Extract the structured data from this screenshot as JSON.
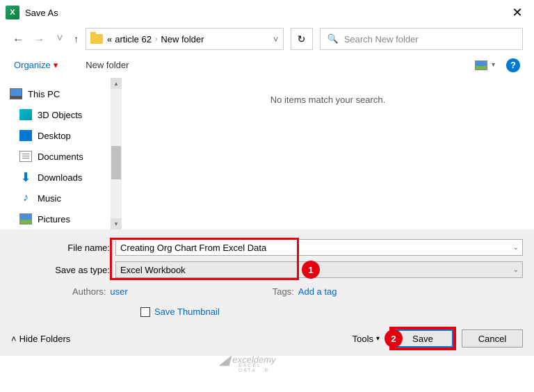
{
  "title": "Save As",
  "breadcrumb": {
    "prefix": "«",
    "p1": "article 62",
    "p2": "New folder"
  },
  "search": {
    "placeholder": "Search New folder"
  },
  "cmdbar": {
    "organize": "Organize",
    "newfolder": "New folder"
  },
  "tree": {
    "pc": "This PC",
    "items": [
      "3D Objects",
      "Desktop",
      "Documents",
      "Downloads",
      "Music",
      "Pictures"
    ]
  },
  "content": {
    "empty": "No items match your search."
  },
  "form": {
    "filename_label": "File name:",
    "filename_value": "Creating Org Chart From Excel Data",
    "type_label": "Save as type:",
    "type_value": "Excel Workbook",
    "authors_label": "Authors:",
    "authors_value": "user",
    "tags_label": "Tags:",
    "tags_value": "Add a tag",
    "save_thumb": "Save Thumbnail"
  },
  "buttons": {
    "hide": "Hide Folders",
    "tools": "Tools",
    "save": "Save",
    "cancel": "Cancel"
  },
  "badges": {
    "one": "1",
    "two": "2"
  },
  "watermark": {
    "text": "exceldemy",
    "sub": "EXCEL · DATA · B"
  }
}
